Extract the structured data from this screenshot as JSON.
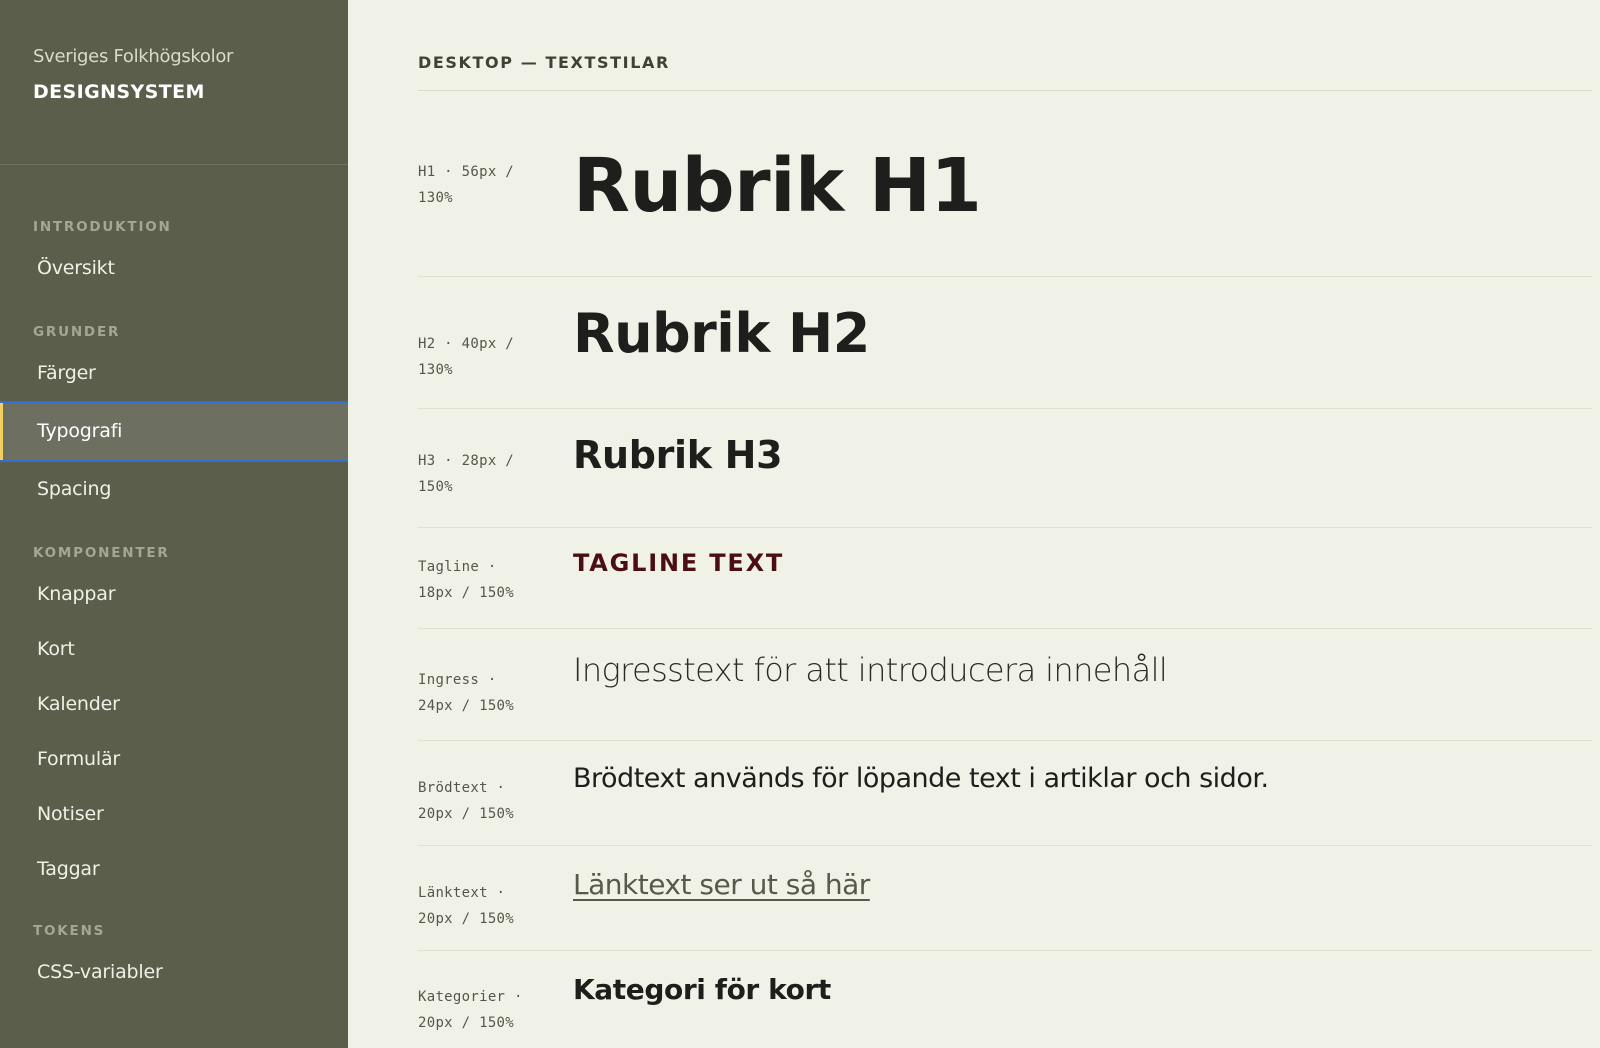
{
  "sidebar": {
    "org": "Sveriges Folkhögskolor",
    "product": "DESIGNSYSTEM",
    "sections": [
      {
        "title": "INTRODUKTION",
        "items": [
          "Översikt"
        ]
      },
      {
        "title": "GRUNDER",
        "items": [
          "Färger",
          "Typografi",
          "Spacing"
        ]
      },
      {
        "title": "KOMPONENTER",
        "items": [
          "Knappar",
          "Kort",
          "Kalender",
          "Formulär",
          "Notiser",
          "Taggar"
        ]
      },
      {
        "title": "TOKENS",
        "items": [
          "CSS-variabler"
        ]
      }
    ],
    "active_item": "Typografi"
  },
  "main": {
    "title": "DESKTOP — TEXTSTILAR",
    "styles": [
      {
        "spec_line1": "H1 · 56px /",
        "spec_line2": "130%",
        "sample": "Rubrik H1"
      },
      {
        "spec_line1": "H2 · 40px /",
        "spec_line2": "130%",
        "sample": "Rubrik H2"
      },
      {
        "spec_line1": "H3 · 28px /",
        "spec_line2": "150%",
        "sample": "Rubrik H3"
      },
      {
        "spec_line1": "Tagline ·",
        "spec_line2": "18px / 150%",
        "sample": "TAGLINE TEXT"
      },
      {
        "spec_line1": "Ingress ·",
        "spec_line2": "24px / 150%",
        "sample": "Ingresstext för att introducera innehåll"
      },
      {
        "spec_line1": "Brödtext ·",
        "spec_line2": "20px / 150%",
        "sample": "Brödtext används för löpande text i artiklar och sidor."
      },
      {
        "spec_line1": "Länktext ·",
        "spec_line2": "20px / 150%",
        "sample": "Länktext ser ut så här"
      },
      {
        "spec_line1": "Kategorier ·",
        "spec_line2": "20px / 150%",
        "sample": "Kategori för kort"
      }
    ]
  },
  "colors": {
    "sidebar_bg": "#5b5e4a",
    "page_bg": "#f1f2e7",
    "active_item_bg": "#6d6f60",
    "focus_ring": "#2f6fd6",
    "active_marker": "#f2cf63",
    "tagline": "#4b0d16"
  }
}
